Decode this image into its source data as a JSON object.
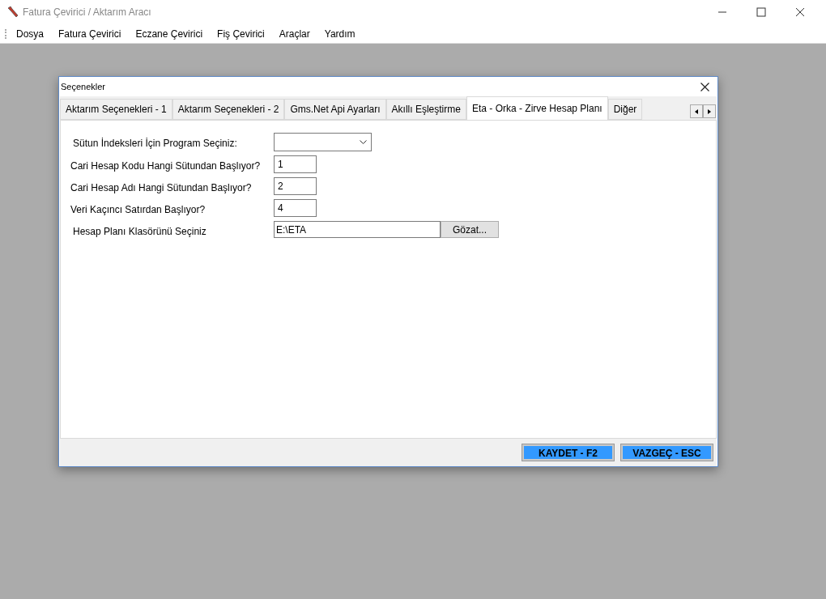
{
  "window": {
    "title": "Fatura Çevirici / Aktarım Aracı"
  },
  "menu": [
    "Dosya",
    "Fatura Çevirici",
    "Eczane Çevirici",
    "Fiş Çevirici",
    "Araçlar",
    "Yardım"
  ],
  "dialog": {
    "title": "Seçenekler",
    "tabs": [
      {
        "label": "Aktarım Seçenekleri - 1",
        "selected": false
      },
      {
        "label": "Aktarım Seçenekleri - 2",
        "selected": false
      },
      {
        "label": "Gms.Net Api Ayarları",
        "selected": false
      },
      {
        "label": "Akıllı Eşleştirme",
        "selected": false
      },
      {
        "label": "Eta - Orka - Zirve Hesap Planı",
        "selected": true
      },
      {
        "label": "Diğer",
        "selected": false
      }
    ],
    "fields": [
      {
        "kind": "select",
        "label": "Sütun İndeksleri İçin Program Seçiniz:"
      },
      {
        "kind": "text",
        "label": "Cari Hesap Kodu Hangi Sütundan Başlıyor?",
        "value": "1"
      },
      {
        "kind": "text",
        "label": "Cari Hesap Adı Hangi Sütundan Başlıyor?",
        "value": "2"
      },
      {
        "kind": "text",
        "label": "Veri Kaçıncı Satırdan Başlıyor?",
        "value": "4"
      },
      {
        "kind": "folder",
        "label": "Hesap Planı Klasörünü Seçiniz",
        "value": "E:\\ETA",
        "button": "Gözat..."
      }
    ],
    "buttons": [
      "KAYDET - F2",
      "VAZGEÇ - ESC"
    ]
  }
}
